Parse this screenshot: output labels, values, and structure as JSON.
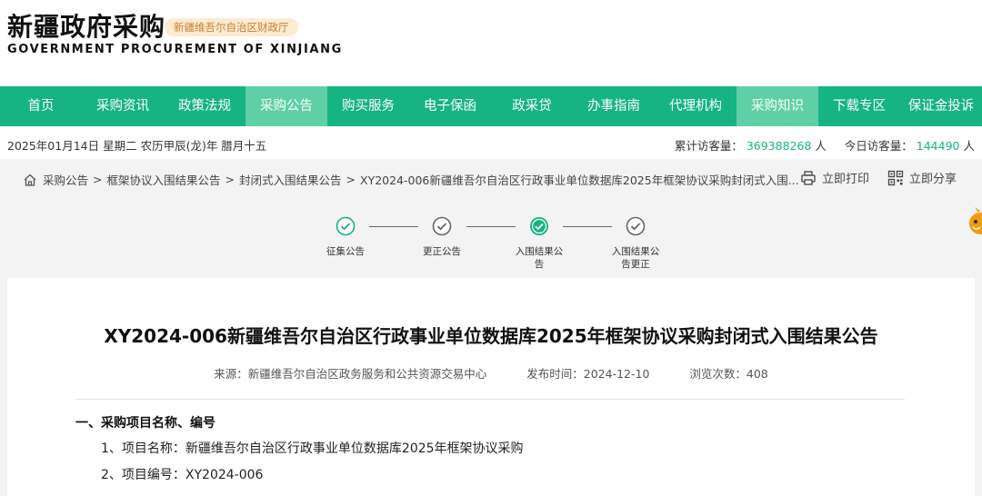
{
  "header": {
    "title": "新疆政府采购",
    "badge": "新疆维吾尔自治区财政厅",
    "subtitle": "GOVERNMENT PROCUREMENT OF XINJIANG"
  },
  "nav": {
    "items": [
      {
        "label": "首页"
      },
      {
        "label": "采购资讯"
      },
      {
        "label": "政策法规"
      },
      {
        "label": "采购公告"
      },
      {
        "label": "购买服务"
      },
      {
        "label": "电子保函"
      },
      {
        "label": "政采贷"
      },
      {
        "label": "办事指南"
      },
      {
        "label": "代理机构"
      },
      {
        "label": "采购知识"
      },
      {
        "label": "下载专区"
      },
      {
        "label": "保证金投诉"
      }
    ]
  },
  "info": {
    "date": "2025年01月14日 星期二 农历甲辰(龙)年 腊月十五",
    "total_label": "累计访客量：",
    "total_value": "369388268",
    "today_label": "今日访客量：",
    "today_value": "144490",
    "unit": "人"
  },
  "breadcrumb": {
    "items": [
      "采购公告",
      "框架协议入围结果公告",
      "封闭式入围结果公告",
      "XY2024-006新疆维吾尔自治区行政事业单位数据库2025年框架协议采购封闭式入围..."
    ],
    "separator": ">"
  },
  "actions": {
    "print": "立即打印",
    "share": "立即分享"
  },
  "steps": {
    "s1": "征集公告",
    "s2": "更正公告",
    "s3a": "入围结果公",
    "s3b": "告",
    "s4a": "入围结果公",
    "s4b": "告更正"
  },
  "article": {
    "title": "XY2024-006新疆维吾尔自治区行政事业单位数据库2025年框架协议采购封闭式入围结果公告",
    "source": "来源：新疆维吾尔自治区政务服务和公共资源交易中心",
    "publish": "发布时间：2024-12-10",
    "views": "浏览次数：408",
    "section1": "一、采购项目名称、编号",
    "item1": "1、项目名称：新疆维吾尔自治区行政事业单位数据库2025年框架协议采购",
    "item2": "2、项目编号：XY2024-006"
  }
}
